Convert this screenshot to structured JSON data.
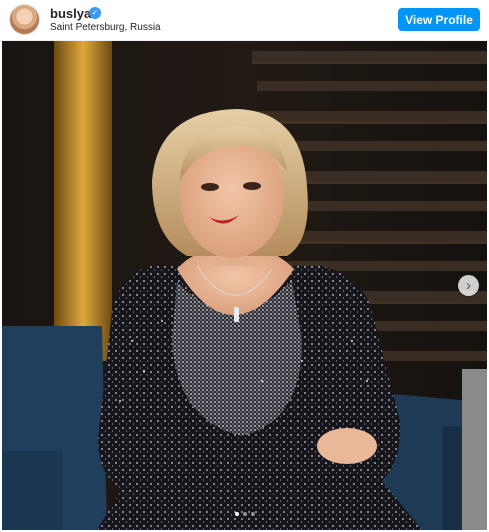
{
  "profile": {
    "username": "buslya",
    "location": "Saint Petersburg, Russia",
    "verified_icon": "verified-badge-icon",
    "avatar_icon": "profile-avatar"
  },
  "header": {
    "view_profile_label": "View Profile"
  },
  "carousel": {
    "next_icon": "chevron-right-icon",
    "next_glyph": "›",
    "slide_count": 3,
    "active_slide": 1
  },
  "colors": {
    "accent": "#0095f6",
    "text": "#262626",
    "verified": "#3897f0"
  }
}
